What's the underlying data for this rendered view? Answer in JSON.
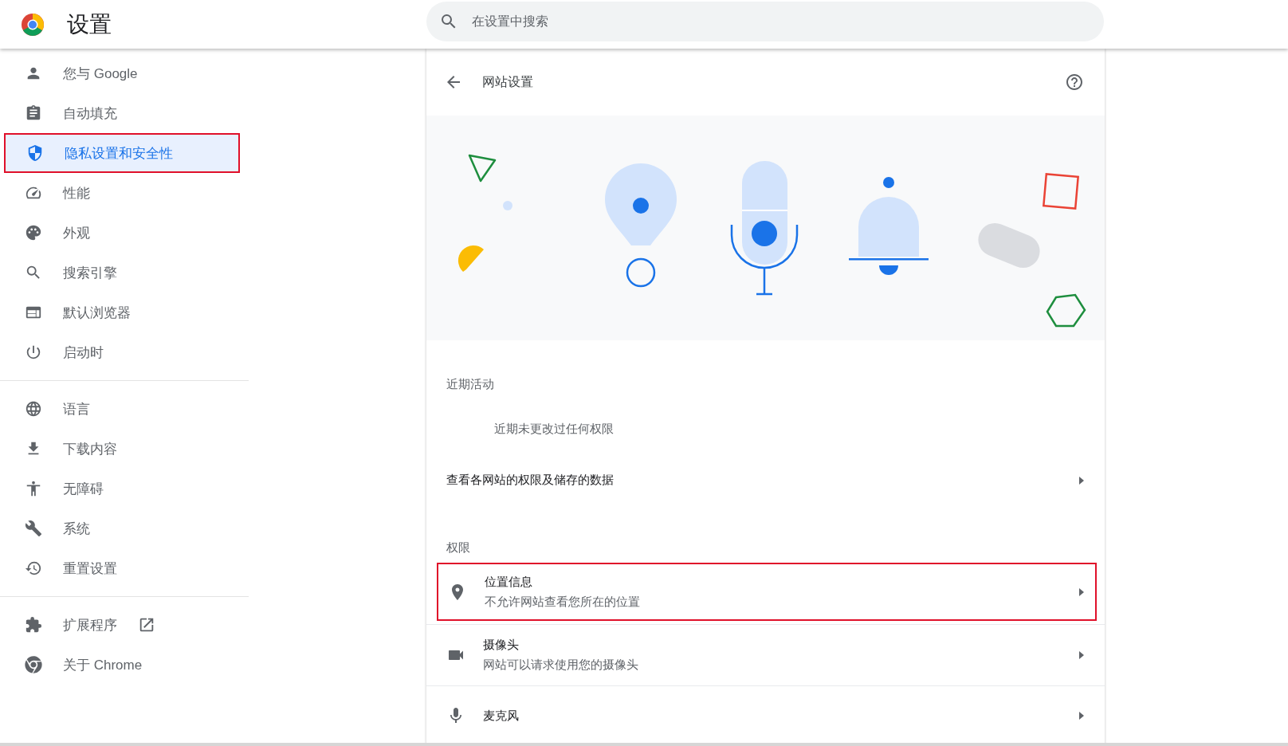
{
  "header": {
    "title": "设置",
    "search": {
      "placeholder": "在设置中搜索"
    }
  },
  "sidebar": {
    "groups": [
      {
        "items": [
          {
            "label": "您与 Google",
            "selected": false,
            "marked": false
          },
          {
            "label": "自动填充",
            "selected": false,
            "marked": false
          },
          {
            "label": "隐私设置和安全性",
            "selected": true,
            "marked": true
          },
          {
            "label": "性能",
            "selected": false,
            "marked": false
          },
          {
            "label": "外观",
            "selected": false,
            "marked": false
          },
          {
            "label": "搜索引擎",
            "selected": false,
            "marked": false
          },
          {
            "label": "默认浏览器",
            "selected": false,
            "marked": false
          },
          {
            "label": "启动时",
            "selected": false,
            "marked": false
          }
        ]
      },
      {
        "items": [
          {
            "label": "语言",
            "selected": false,
            "marked": false
          },
          {
            "label": "下载内容",
            "selected": false,
            "marked": false
          },
          {
            "label": "无障碍",
            "selected": false,
            "marked": false
          },
          {
            "label": "系统",
            "selected": false,
            "marked": false
          },
          {
            "label": "重置设置",
            "selected": false,
            "marked": false
          }
        ]
      },
      {
        "items": [
          {
            "label": "扩展程序",
            "selected": false,
            "marked": false,
            "external": true
          },
          {
            "label": "关于 Chrome",
            "selected": false,
            "marked": false
          }
        ]
      }
    ]
  },
  "page": {
    "title": "网站设置",
    "sections": [
      {
        "heading": "近期活动",
        "rows": [
          {
            "kind": "note",
            "title": "近期未更改过任何权限"
          },
          {
            "kind": "link",
            "title": "查看各网站的权限及储存的数据"
          }
        ]
      },
      {
        "heading": "权限",
        "rows": [
          {
            "kind": "permission",
            "title": "位置信息",
            "subtitle": "不允许网站查看您所在的位置",
            "marked": true
          },
          {
            "kind": "permission",
            "title": "摄像头",
            "subtitle": "网站可以请求使用您的摄像头",
            "marked": false
          },
          {
            "kind": "permission",
            "title": "麦克风",
            "marked": false
          }
        ]
      }
    ]
  }
}
